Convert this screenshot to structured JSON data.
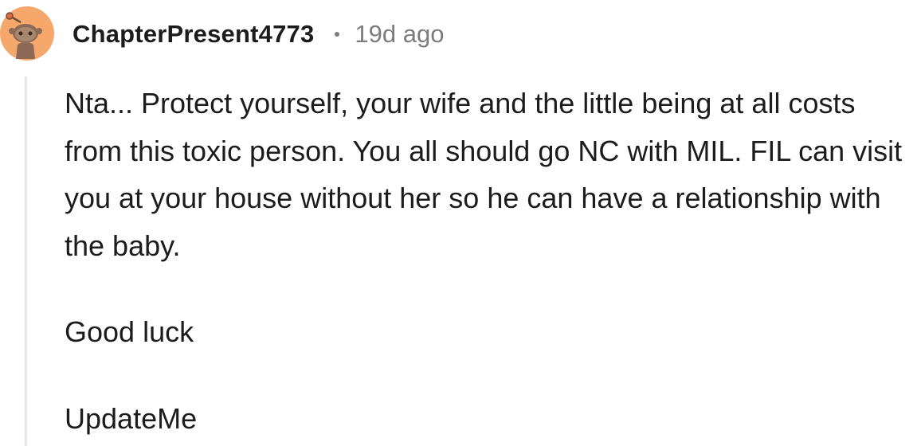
{
  "comment": {
    "author": "ChapterPresent4773",
    "separator_icon": "dot-icon",
    "timestamp": "19d ago",
    "avatar_icon": "reddit-snoo-avatar-icon",
    "paragraphs": [
      "Nta... Protect yourself, your wife and the little being at all costs from this toxic person. You all should go NC with MIL. FIL can visit you at your house without her so he can have a relationship with the baby.",
      "Good luck",
      "UpdateMe"
    ]
  },
  "colors": {
    "avatar_bg": "#F5A76C",
    "avatar_figure": "#6B4E3D",
    "meta_gray": "#7C7C7C",
    "thread_line": "#E5E5E5",
    "text": "#1C1C1C"
  }
}
